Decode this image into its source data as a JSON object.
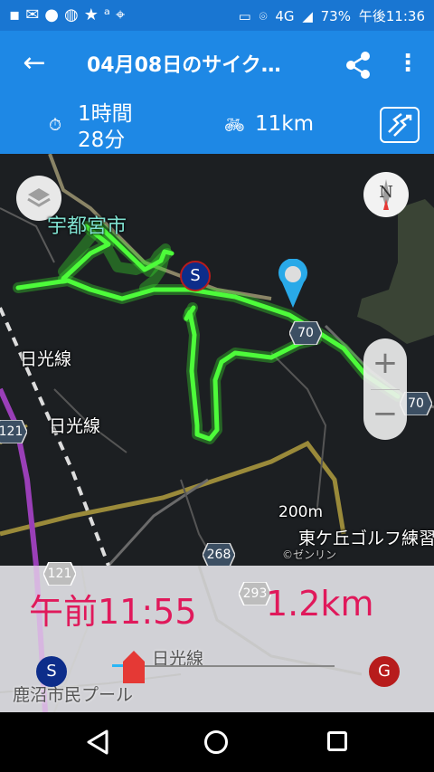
{
  "status_bar": {
    "icons": [
      "message-icon",
      "gmail-icon",
      "notification-icon",
      "android-icon",
      "star-icon",
      "steps-icon",
      "location-icon",
      "cast-icon",
      "location-pin-icon",
      "signal-icon"
    ],
    "network": "4G",
    "battery": "73%",
    "time": "午後11:36"
  },
  "app_bar": {
    "title": "04月08日のサイク…"
  },
  "stats": {
    "duration": "1時間\n28分",
    "distance": "11km"
  },
  "map": {
    "labels": {
      "city": "宇都宮市",
      "line1": "日光線",
      "line2": "日光線",
      "scale": "200m",
      "golf": "東ケ丘ゴルフ練習",
      "copyright": "©ゼンリン"
    },
    "shields": {
      "r70a": "70",
      "r70b": "70",
      "r121": "121",
      "r268": "268",
      "r121b": "121",
      "r293": "293"
    },
    "start_marker": "S",
    "compass_letter": "N",
    "route_color": "#39e82a"
  },
  "playback": {
    "time": "午前11:55",
    "distance": "1.2km",
    "start_label": "S",
    "goal_label": "G",
    "progress": 0.05,
    "bg_labels": {
      "line": "日光線",
      "pool": "鹿沼市民プール"
    }
  }
}
